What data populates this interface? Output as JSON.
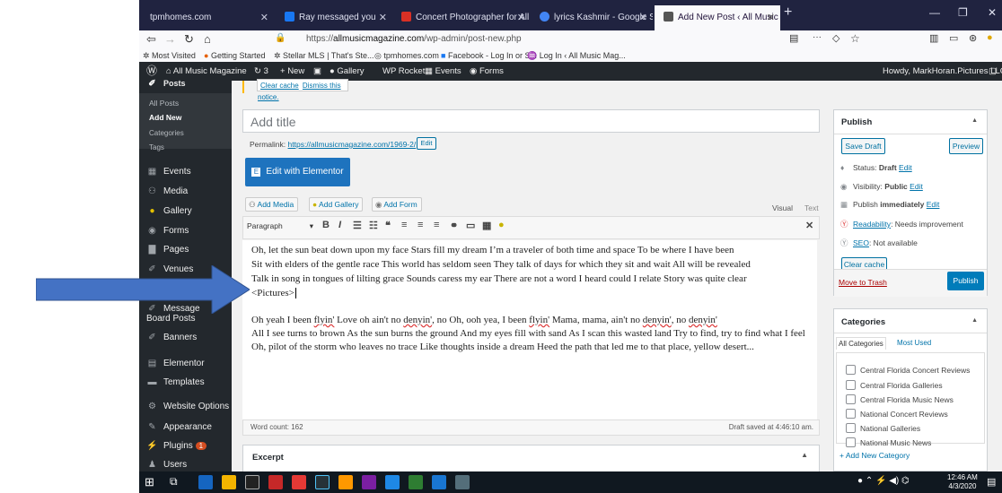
{
  "browser": {
    "tabs": [
      {
        "title": "tpmhomes.com",
        "active": false,
        "color": "#202340"
      },
      {
        "title": "Ray messaged you",
        "active": false,
        "color": "#1877f2"
      },
      {
        "title": "Concert Photographer for All M",
        "active": false,
        "color": "#d93025"
      },
      {
        "title": "lyrics Kashmir - Google Search",
        "active": false,
        "color": "#4285f4"
      },
      {
        "title": "Add New Post ‹ All Music Maga",
        "active": true,
        "color": "#23282d"
      }
    ],
    "url_prefix": "https://",
    "url_domain": "allmusicmagazine.com",
    "url_path": "/wp-admin/post-new.php",
    "bookmarks": [
      "Most Visited",
      "Getting Started",
      "Stellar MLS | That's Ste...",
      "tpmhomes.com",
      "Facebook - Log In or S...",
      "Log In ‹ All Music Mag..."
    ]
  },
  "adminbar": {
    "site": "All Music Magazine",
    "updates": "3",
    "new": "New",
    "gallery": "Gallery",
    "rocket": "WP Rocket",
    "events": "Events",
    "forms": "Forms",
    "howdy": "Howdy, MarkHoran.Pictures LLC"
  },
  "sidebar": {
    "top_label": "Posts",
    "submenu": [
      "All Posts",
      "Add New",
      "Categories",
      "Tags"
    ],
    "items": [
      {
        "label": "Events",
        "icon": "calendar-icon"
      },
      {
        "label": "Media",
        "icon": "media-icon"
      },
      {
        "label": "Gallery",
        "icon": "gallery-icon"
      },
      {
        "label": "Forms",
        "icon": "forms-icon"
      },
      {
        "label": "Pages",
        "icon": "pages-icon"
      },
      {
        "label": "Venues",
        "icon": "pin-icon"
      },
      {
        "label": "Message Board Posts",
        "icon": "pin-icon"
      },
      {
        "label": "Banners",
        "icon": "pin-icon"
      },
      {
        "label": "Elementor",
        "icon": "elementor-icon"
      },
      {
        "label": "Templates",
        "icon": "folder-icon"
      },
      {
        "label": "Website Options",
        "icon": "gear-icon"
      },
      {
        "label": "Appearance",
        "icon": "brush-icon"
      },
      {
        "label": "Plugins",
        "icon": "plug-icon",
        "badge": "1"
      },
      {
        "label": "Users",
        "icon": "user-icon"
      }
    ]
  },
  "notice": {
    "clear_cache": "Clear cache",
    "dismiss": "Dismiss this notice."
  },
  "post": {
    "title_placeholder": "Add title",
    "permalink_label": "Permalink:",
    "permalink_url": "https://allmusicmagazine.com/1969-2/",
    "edit_label": "Edit",
    "elementor_button": "Edit with Elementor",
    "add_media": "Add Media",
    "add_gallery": "Add Gallery",
    "add_form": "Add Form",
    "tab_visual": "Visual",
    "tab_text": "Text",
    "format": "Paragraph",
    "lines": [
      "Oh, let the sun beat down upon my face Stars fill my dream I’m a traveler of both time and space To be where I have been",
      "Sit with elders of the gentle race This world has seldom seen They talk of days for which they sit and wait All will be revealed",
      "Talk in song in tongues of lilting grace Sounds caress my ear There are not a word I heard could I relate Story was quite clear",
      "<Pictures>"
    ],
    "line5_a": "Oh yeah I been ",
    "line5_flyin1": "flyin'",
    "line5_b": " Love oh ain't no ",
    "line5_denyin1": "denyin'",
    "line5_c": ", no Oh, ooh yea, I been ",
    "line5_flyin2": "flyin'",
    "line5_d": " Mama, mama, ain't no ",
    "line5_denyin2": "denyin'",
    "line5_e": ", no ",
    "line5_denyin3": "denyin'",
    "line6": "All I see turns to brown As the sun burns the ground And my eyes fill with sand As I scan this wasted land Try to find, try to find what I feel",
    "line7": "Oh, pilot of the storm who leaves no trace Like thoughts inside a dream Heed the path that led me to that place, yellow desert...",
    "word_count": "Word count: 162",
    "draft_saved": "Draft saved at 4:46:10 am.",
    "excerpt": "Excerpt"
  },
  "publish": {
    "title": "Publish",
    "save_draft": "Save Draft",
    "preview": "Preview",
    "status_label": "Status: ",
    "status_value": "Draft",
    "visibility_label": "Visibility: ",
    "visibility_value": "Public",
    "publish_label": "Publish ",
    "publish_value": "immediately",
    "readability_link": "Readability",
    "readability_value": ": Needs improvement",
    "seo_link": "SEO",
    "seo_value": ": Not available",
    "edit": "Edit",
    "clear_cache": "Clear cache",
    "trash": "Move to Trash",
    "publish_button": "Publish"
  },
  "categories": {
    "title": "Categories",
    "tab_all": "All Categories",
    "tab_most": "Most Used",
    "items": [
      "Central Florida Concert Reviews",
      "Central Florida Galleries",
      "Central Florida Music News",
      "National Concert Reviews",
      "National Galleries",
      "National Music News"
    ],
    "add_new": "+ Add New Category"
  },
  "taskbar": {
    "time": "12:46 AM",
    "date": "4/3/2020"
  },
  "colors": {
    "arrow": "#4472c4",
    "primary": "#0073aa",
    "elementor": "#1e73be",
    "trash": "#a00"
  }
}
